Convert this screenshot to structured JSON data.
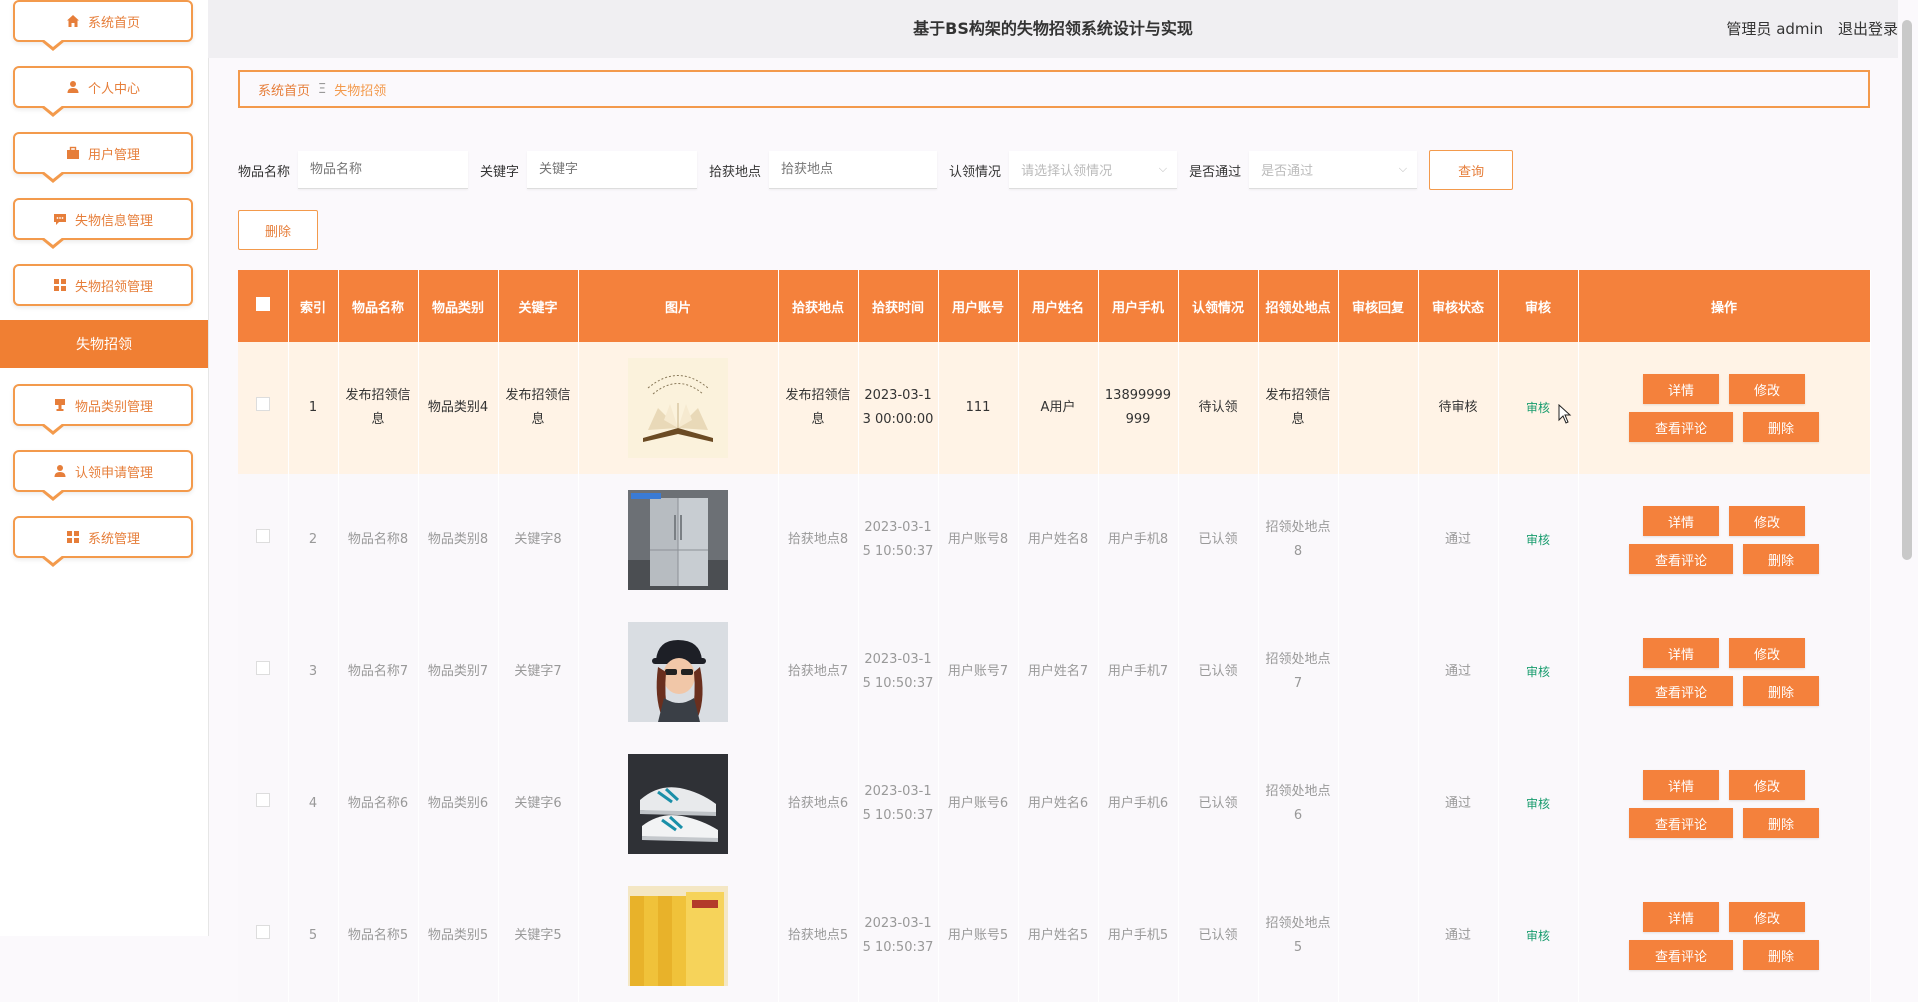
{
  "app": {
    "title": "基于BS构架的失物招领系统设计与实现"
  },
  "header": {
    "user_label": "管理员 admin",
    "logout_label": "退出登录"
  },
  "sidebar": {
    "items": [
      {
        "label": "系统首页",
        "icon": "home-icon"
      },
      {
        "label": "个人中心",
        "icon": "user-icon"
      },
      {
        "label": "用户管理",
        "icon": "briefcase-icon"
      },
      {
        "label": "失物信息管理",
        "icon": "chat-icon"
      },
      {
        "label": "失物招领管理",
        "icon": "grid-icon"
      },
      {
        "label": "物品类别管理",
        "icon": "cup-icon"
      },
      {
        "label": "认领申请管理",
        "icon": "user-icon"
      },
      {
        "label": "系统管理",
        "icon": "grid-icon"
      }
    ],
    "active_sub": "失物招领"
  },
  "breadcrumb": {
    "home": "系统首页",
    "sep": "Ξ",
    "current": "失物招领"
  },
  "search": {
    "item_name_label": "物品名称",
    "item_name_placeholder": "物品名称",
    "keyword_label": "关键字",
    "keyword_placeholder": "关键字",
    "location_label": "拾获地点",
    "location_placeholder": "拾获地点",
    "claim_label": "认领情况",
    "claim_placeholder": "请选择认领情况",
    "pass_label": "是否通过",
    "pass_placeholder": "是否通过",
    "query_button": "查询"
  },
  "toolbar": {
    "delete_label": "删除"
  },
  "table": {
    "headers": [
      "索引",
      "物品名称",
      "物品类别",
      "关键字",
      "图片",
      "拾获地点",
      "拾获时间",
      "用户账号",
      "用户姓名",
      "用户手机",
      "认领情况",
      "招领处地点",
      "审核回复",
      "审核状态",
      "审核",
      "操作"
    ],
    "rows": [
      {
        "index": "1",
        "name": "发布招领信息",
        "category": "物品类别4",
        "keyword": "发布招领信息",
        "image": "book-photo",
        "location": "发布招领信息",
        "time": "2023-03-13 00:00:00",
        "account": "111",
        "username": "A用户",
        "phone": "13899999999",
        "claim": "待认领",
        "office": "发布招领信息",
        "reply": "",
        "status": "待审核",
        "audit": "审核"
      },
      {
        "index": "2",
        "name": "物品名称8",
        "category": "物品类别8",
        "keyword": "关键字8",
        "image": "fridge-photo",
        "location": "拾获地点8",
        "time": "2023-03-15 10:50:37",
        "account": "用户账号8",
        "username": "用户姓名8",
        "phone": "用户手机8",
        "claim": "已认领",
        "office": "招领处地点8",
        "reply": "",
        "status": "通过",
        "audit": "审核"
      },
      {
        "index": "3",
        "name": "物品名称7",
        "category": "物品类别7",
        "keyword": "关键字7",
        "image": "hat-woman-photo",
        "location": "拾获地点7",
        "time": "2023-03-15 10:50:37",
        "account": "用户账号7",
        "username": "用户姓名7",
        "phone": "用户手机7",
        "claim": "已认领",
        "office": "招领处地点7",
        "reply": "",
        "status": "通过",
        "audit": "审核"
      },
      {
        "index": "4",
        "name": "物品名称6",
        "category": "物品类别6",
        "keyword": "关键字6",
        "image": "sneaker-photo",
        "location": "拾获地点6",
        "time": "2023-03-15 10:50:37",
        "account": "用户账号6",
        "username": "用户姓名6",
        "phone": "用户手机6",
        "claim": "已认领",
        "office": "招领处地点6",
        "reply": "",
        "status": "通过",
        "audit": "审核"
      },
      {
        "index": "5",
        "name": "物品名称5",
        "category": "物品类别5",
        "keyword": "关键字5",
        "image": "books-photo",
        "location": "拾获地点5",
        "time": "2023-03-15 10:50:37",
        "account": "用户账号5",
        "username": "用户姓名5",
        "phone": "用户手机5",
        "claim": "已认领",
        "office": "招领处地点5",
        "reply": "",
        "status": "通过",
        "audit": "审核"
      }
    ],
    "ops": {
      "detail": "详情",
      "edit": "修改",
      "comments": "查看评论",
      "delete": "删除"
    }
  },
  "colors": {
    "accent": "#f4813c",
    "highlight_row": "#fff3e6",
    "audit_link": "#1a9d6f"
  }
}
